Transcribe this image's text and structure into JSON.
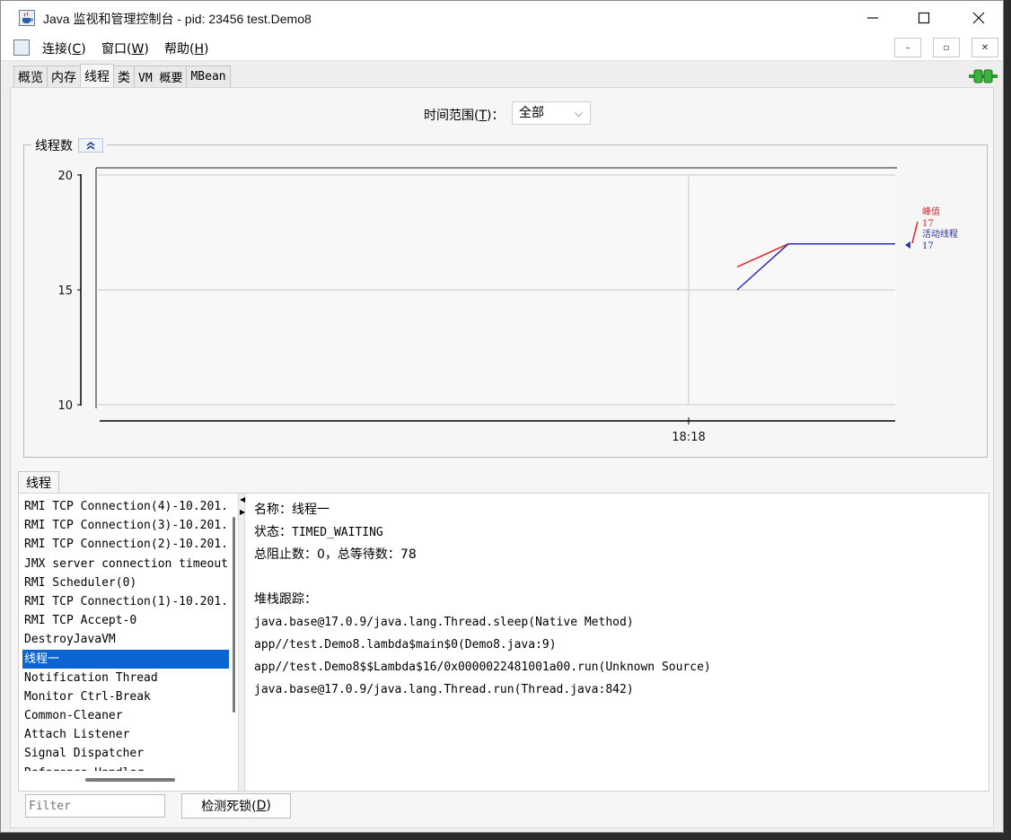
{
  "window": {
    "title": "Java 监视和管理控制台 - pid: 23456 test.Demo8",
    "minimize_icon": "minimize-icon",
    "maximize_icon": "maximize-icon",
    "close_icon": "close-icon"
  },
  "menubar": {
    "items": [
      {
        "label": "连接",
        "mnemonic": "C"
      },
      {
        "label": "窗口",
        "mnemonic": "W"
      },
      {
        "label": "帮助",
        "mnemonic": "H"
      }
    ],
    "inner_buttons": [
      "–",
      "▫",
      "✕"
    ]
  },
  "tabs": [
    {
      "label": "概览",
      "active": false
    },
    {
      "label": "内存",
      "active": false
    },
    {
      "label": "线程",
      "active": true
    },
    {
      "label": "类",
      "active": false
    },
    {
      "label": "VM 概要",
      "active": false
    },
    {
      "label": "MBean",
      "active": false
    }
  ],
  "time_range": {
    "label_prefix": "时间范围(",
    "mnemonic": "T",
    "label_suffix": ")：",
    "selected": "全部"
  },
  "chart_group": {
    "title": "线程数"
  },
  "chart_data": {
    "type": "line",
    "title": "线程数",
    "xlabel": "",
    "ylabel": "",
    "x_ticks": [
      "18:18"
    ],
    "y_ticks": [
      10,
      15,
      20
    ],
    "ylim": [
      10,
      20
    ],
    "grid": true,
    "legend_position": "right",
    "series": [
      {
        "name": "峰值",
        "value_label": "17",
        "color": "#e0262b",
        "points": [
          [
            0,
            16
          ],
          [
            1,
            17
          ],
          [
            2,
            17
          ]
        ]
      },
      {
        "name": "活动线程",
        "value_label": "17",
        "color": "#2a2fb0",
        "points": [
          [
            0,
            15
          ],
          [
            1,
            17
          ],
          [
            2,
            17
          ]
        ]
      }
    ]
  },
  "thread_panel": {
    "tab_label": "线程",
    "threads": [
      "RMI TCP Connection(4)-10.201.",
      "RMI TCP Connection(3)-10.201.",
      "RMI TCP Connection(2)-10.201.",
      "JMX server connection timeout",
      "RMI Scheduler(0)",
      "RMI TCP Connection(1)-10.201.",
      "RMI TCP Accept-0",
      "DestroyJavaVM",
      "线程一",
      "Notification Thread",
      "Monitor Ctrl-Break",
      "Common-Cleaner",
      "Attach Listener",
      "Signal Dispatcher",
      "Reference Handler"
    ],
    "selected_index": 8,
    "detail": {
      "name_label": "名称：",
      "name": "线程一",
      "state_label": "状态：",
      "state": "TIMED_WAITING",
      "counts": "总阻止数：0，总等待数：78",
      "stack_label": "堆栈跟踪：",
      "stack": [
        "java.base@17.0.9/java.lang.Thread.sleep(Native Method)",
        "app//test.Demo8.lambda$main$0(Demo8.java:9)",
        "app//test.Demo8$$Lambda$16/0x0000022481001a00.run(Unknown Source)",
        "java.base@17.0.9/java.lang.Thread.run(Thread.java:842)"
      ]
    },
    "filter_placeholder": "Filter",
    "deadlock_button": {
      "label_prefix": "检测死锁(",
      "mnemonic": "D",
      "label_suffix": ")"
    }
  }
}
